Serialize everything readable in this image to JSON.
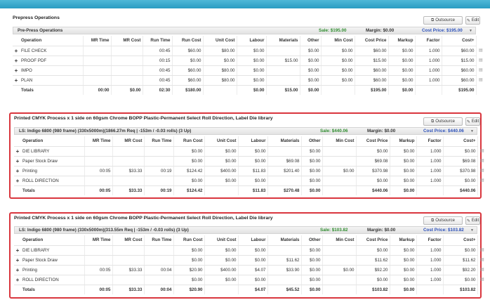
{
  "columns": [
    "Operation",
    "MR Time",
    "MR Cost",
    "Run Time",
    "Run Cost",
    "Unit Cost",
    "Labour",
    "Materials",
    "Other",
    "Min Cost",
    "Cost Price",
    "Markup",
    "Factor",
    "Cost+"
  ],
  "buttons": {
    "outsource": "Outsource",
    "edit": "Edit"
  },
  "icons": {
    "outsource": "external-link-icon",
    "edit": "edit-icon",
    "comment": "comment-icon",
    "expand": "plus-icon",
    "toggle": "chevron-down-icon"
  },
  "colors": {
    "highlight_border": "#d9363e",
    "sale": "#2e8b2e",
    "cost_price": "#2a4fb8",
    "top_bar": "#2a9cc2"
  },
  "sections": [
    {
      "title": "Prepress Operations",
      "subheader": "Pre-Press Operations",
      "sale": "Sale: $195.00",
      "margin": "Margin: $0.00",
      "cost_price": "Cost Price: $195.00",
      "rows": [
        [
          "FILE CHECK",
          "",
          "",
          "00:45",
          "$60.00",
          "$80.00",
          "$0.00",
          "",
          "$0.00",
          "$0.00",
          "$60.00",
          "$0.00",
          "1.000",
          "$60.00"
        ],
        [
          "PROOF PDF",
          "",
          "",
          "00:15",
          "$0.00",
          "$0.00",
          "$0.00",
          "$15.00",
          "$0.00",
          "$0.00",
          "$15.00",
          "$0.00",
          "1.000",
          "$15.00"
        ],
        [
          "IMPO",
          "",
          "",
          "00:45",
          "$60.00",
          "$80.00",
          "$0.00",
          "",
          "$0.00",
          "$0.00",
          "$60.00",
          "$0.00",
          "1.000",
          "$60.00"
        ],
        [
          "PLAN",
          "",
          "",
          "00:45",
          "$60.00",
          "$80.00",
          "$0.00",
          "",
          "$0.00",
          "$0.00",
          "$60.00",
          "$0.00",
          "1.000",
          "$60.00"
        ]
      ],
      "totals": [
        "Totals",
        "00:00",
        "$0.00",
        "02:30",
        "$180.00",
        "",
        "$0.00",
        "$15.00",
        "$0.00",
        "",
        "$195.00",
        "$0.00",
        "",
        "$195.00"
      ]
    },
    {
      "title": "Printed CMYK Process x 1 side on 60gsm Chrome BOPP Plastic-Permanent Select Roll Direction, Label Die library",
      "subheader": "LS: Indigo 6800 (980 frame) (330x5000m)(1866.27m Req | -153m / -0.03 rolls) (3 Up)",
      "sale": "Sale: $440.06",
      "margin": "Margin: $0.00",
      "cost_price": "Cost Price: $440.06",
      "rows": [
        [
          "DIE LIBRARY",
          "",
          "",
          "",
          "$0.00",
          "$0.00",
          "$0.00",
          "",
          "$0.00",
          "",
          "$0.00",
          "$0.00",
          "1.000",
          "$0.00"
        ],
        [
          "Paper Stock Draw",
          "",
          "",
          "",
          "$0.00",
          "$0.00",
          "$0.00",
          "$69.08",
          "$0.00",
          "",
          "$69.08",
          "$0.00",
          "1.000",
          "$69.08"
        ],
        [
          "Printing",
          "00:05",
          "$33.33",
          "00:19",
          "$124.42",
          "$400.00",
          "$11.83",
          "$201.40",
          "$0.00",
          "$0.00",
          "$370.98",
          "$0.00",
          "1.000",
          "$370.98"
        ],
        [
          "ROLL DIRECTION",
          "",
          "",
          "",
          "$0.00",
          "$0.00",
          "$0.00",
          "",
          "$0.00",
          "",
          "$0.00",
          "$0.00",
          "1.000",
          "$0.00"
        ]
      ],
      "totals": [
        "Totals",
        "00:05",
        "$33.33",
        "00:19",
        "$124.42",
        "",
        "$11.83",
        "$270.48",
        "$0.00",
        "",
        "$440.06",
        "$0.00",
        "",
        "$440.06"
      ]
    },
    {
      "title": "Printed CMYK Process x 1 side on 60gsm Chrome BOPP Plastic-Permanent Select Roll Direction, Label Die library",
      "subheader": "LS: Indigo 6800 (980 frame) (330x5000m)(313.55m Req | -153m / -0.03 rolls) (3 Up)",
      "sale": "Sale: $103.82",
      "margin": "Margin: $0.00",
      "cost_price": "Cost Price: $103.82",
      "rows": [
        [
          "DIE LIBRARY",
          "",
          "",
          "",
          "$0.00",
          "$0.00",
          "$0.00",
          "",
          "$0.00",
          "",
          "$0.00",
          "$0.00",
          "1.000",
          "$0.00"
        ],
        [
          "Paper Stock Draw",
          "",
          "",
          "",
          "$0.00",
          "$0.00",
          "$0.00",
          "$11.62",
          "$0.00",
          "",
          "$11.62",
          "$0.00",
          "1.000",
          "$11.62"
        ],
        [
          "Printing",
          "00:05",
          "$33.33",
          "00:04",
          "$20.90",
          "$400.00",
          "$4.07",
          "$33.90",
          "$0.00",
          "$0.00",
          "$92.20",
          "$0.00",
          "1.000",
          "$92.20"
        ],
        [
          "ROLL DIRECTION",
          "",
          "",
          "",
          "$0.00",
          "$0.00",
          "$0.00",
          "",
          "$0.00",
          "",
          "$0.00",
          "$0.00",
          "1.000",
          "$0.00"
        ]
      ],
      "totals": [
        "Totals",
        "00:05",
        "$33.33",
        "00:04",
        "$20.90",
        "",
        "$4.07",
        "$45.52",
        "$0.00",
        "",
        "$103.82",
        "$0.00",
        "",
        "$103.82"
      ]
    }
  ]
}
